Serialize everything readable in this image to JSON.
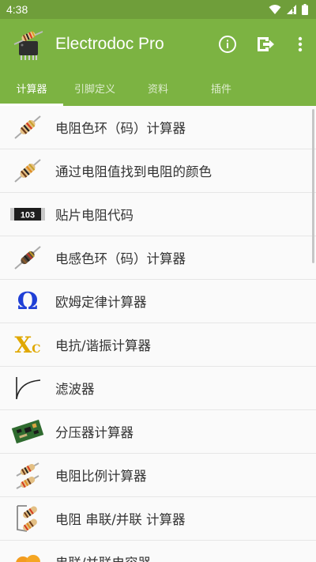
{
  "status": {
    "time": "4:38"
  },
  "app": {
    "title": "Electrodoc Pro"
  },
  "tabs": [
    {
      "label": "计算器",
      "active": true
    },
    {
      "label": "引脚定义",
      "active": false
    },
    {
      "label": "资料",
      "active": false
    },
    {
      "label": "插件",
      "active": false
    }
  ],
  "items": [
    {
      "label": "电阻色环（码）计算器",
      "icon": "resistor-icon"
    },
    {
      "label": "通过电阻值找到电阻的颜色",
      "icon": "resistor-icon"
    },
    {
      "label": "贴片电阻代码",
      "icon": "smd-resistor-icon",
      "icon_text": "103"
    },
    {
      "label": "电感色环（码）计算器",
      "icon": "inductor-icon"
    },
    {
      "label": "欧姆定律计算器",
      "icon": "omega-icon",
      "icon_text": "Ω"
    },
    {
      "label": "电抗/谐振计算器",
      "icon": "reactance-icon",
      "icon_text": "X",
      "icon_sub": "C"
    },
    {
      "label": "滤波器",
      "icon": "filter-curve-icon"
    },
    {
      "label": "分压器计算器",
      "icon": "circuit-board-icon"
    },
    {
      "label": "电阻比例计算器",
      "icon": "resistor-pair-icon"
    },
    {
      "label": "电阻 串联/并联 计算器",
      "icon": "resistor-network-icon"
    },
    {
      "label": "串联/并联电容器",
      "icon": "capacitor-icon"
    }
  ],
  "colors": {
    "status_bar": "#6f9e3a",
    "app_bar": "#7cb342",
    "accent_orange": "#f39c1f"
  }
}
